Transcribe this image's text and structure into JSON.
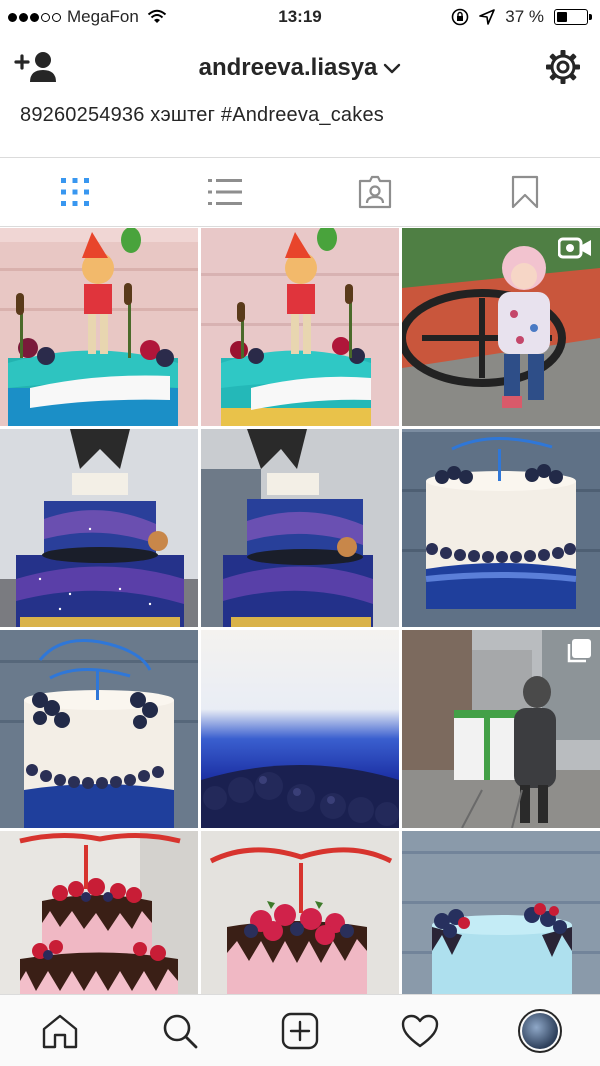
{
  "status_bar": {
    "carrier": "MegaFon",
    "time": "13:19",
    "battery": "37 %",
    "battery_level": 0.37,
    "signal_bars": 3
  },
  "header": {
    "username": "andreeva.liasya",
    "icons": [
      "add-user-icon",
      "chevron-down-icon",
      "gear-icon"
    ]
  },
  "bio": {
    "text": "89260254936 хэштег #Andreeva_cakes"
  },
  "tabs": [
    {
      "icon": "grid-icon",
      "active": true
    },
    {
      "icon": "list-icon",
      "active": false
    },
    {
      "icon": "tagged-icon",
      "active": false
    },
    {
      "icon": "bookmark-icon",
      "active": false
    }
  ],
  "posts": [
    {
      "kind": "pinocchio-cake-1",
      "badge": ""
    },
    {
      "kind": "pinocchio-cake-2",
      "badge": ""
    },
    {
      "kind": "girl-playground",
      "badge": "video-icon"
    },
    {
      "kind": "galaxy-cake-1",
      "badge": ""
    },
    {
      "kind": "galaxy-cake-2",
      "badge": ""
    },
    {
      "kind": "white-blue-cake-1",
      "badge": ""
    },
    {
      "kind": "white-blue-cake-2",
      "badge": ""
    },
    {
      "kind": "blue-ombre-closeup",
      "badge": ""
    },
    {
      "kind": "woman-carrying-box",
      "badge": "multiple-icon"
    },
    {
      "kind": "berry-cake-1",
      "badge": ""
    },
    {
      "kind": "berry-cake-2",
      "badge": ""
    },
    {
      "kind": "light-blue-cake",
      "badge": ""
    }
  ],
  "colors": {
    "accent_blue": "#3897f0",
    "text": "#262626",
    "border": "#dbdbdb"
  },
  "bottom_nav": [
    "home-icon",
    "search-icon",
    "new-post-icon",
    "activity-heart-icon",
    "profile-avatar"
  ]
}
